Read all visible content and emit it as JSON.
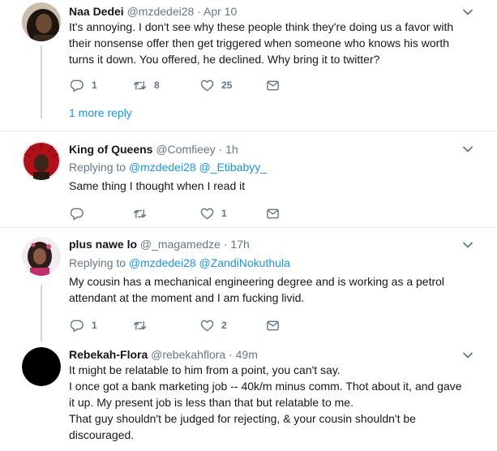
{
  "tweets": [
    {
      "name": "Naa Dedei",
      "handle": "@mzdedei28",
      "dot": "·",
      "time": "Apr 10",
      "body": [
        "It's annoying. I don't see why these people think they're doing us a favor with",
        "their nonsense offer then get triggered when someone who knows his worth",
        "turns it down. You offered, he declined. Why bring it to twitter?"
      ],
      "reply_count": "1",
      "retweet_count": "8",
      "like_count": "25",
      "more_reply": "1 more reply"
    },
    {
      "name": "King of Queens",
      "handle": "@Comfieey",
      "dot": "·",
      "time": "1h",
      "replying_label": "Replying to",
      "mentions": [
        "@mzdedei28",
        "@_Etibabyy_"
      ],
      "body": [
        "Same thing I thought when I read it"
      ],
      "like_count": "1"
    },
    {
      "name": "plus nawe lo",
      "handle": "@_magamedze",
      "dot": "·",
      "time": "17h",
      "replying_label": "Replying to",
      "mentions": [
        "@mzdedei28",
        "@ZandiNokuthula"
      ],
      "body": [
        "My cousin has a mechanical engineering degree and is working as a petrol",
        "attendant at the moment and I am fucking livid."
      ],
      "reply_count": "1",
      "like_count": "2"
    },
    {
      "name": "Rebekah-Flora",
      "handle": "@rebekahflora",
      "dot": "·",
      "time": "49m",
      "body": [
        "It might be relatable to him from a point, you can't say.",
        "I once got a bank marketing job -- 40k/m minus comm. Thot about it, and gave",
        "it up. My present job is less than that but relatable to me.",
        "That guy shouldn't be judged for rejecting, & your cousin shouldn't be",
        "discouraged."
      ]
    }
  ],
  "icons": {
    "reply": "reply-icon",
    "retweet": "retweet-icon",
    "like": "heart-icon",
    "dm": "envelope-icon",
    "more": "chevron-down-icon"
  },
  "colors": {
    "link": "#1b95e0",
    "secondary_text": "#657786",
    "divider": "#e6ecf0",
    "thread_line": "#ccd6dd"
  }
}
